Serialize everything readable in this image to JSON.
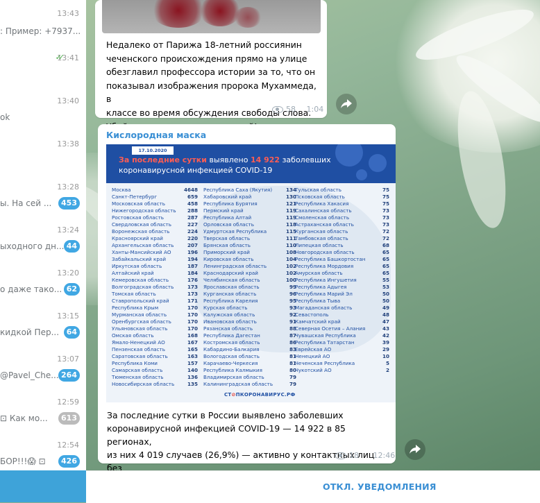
{
  "chat_list": [
    {
      "time": "13:43",
      "preview": "",
      "badge": ""
    },
    {
      "time": "",
      "preview": ": Пример: +7937...",
      "badge": ""
    },
    {
      "time": "13:41",
      "preview": "",
      "badge": "",
      "read": true
    },
    {
      "time": "13:40",
      "preview": "ok",
      "badge": ""
    },
    {
      "time": "13:38",
      "preview": "",
      "badge": ""
    },
    {
      "time": "13:28",
      "preview": "ы.   На сей ...",
      "badge": "453"
    },
    {
      "time": "13:24",
      "preview": "ыходного дн...",
      "badge": "44"
    },
    {
      "time": "13:20",
      "preview": "о даже тако...",
      "badge": "62"
    },
    {
      "time": "13:15",
      "preview": "кидкой  Пер...",
      "badge": "64"
    },
    {
      "time": "13:07",
      "preview": "@Pavel_Che...",
      "badge": "264"
    },
    {
      "time": "12:59",
      "preview": "⊡   Как мо...",
      "badge": "613",
      "muted": true
    },
    {
      "time": "12:54",
      "preview": "БОР!!!😱  ⊡",
      "badge": "426"
    }
  ],
  "messages": [
    {
      "text": "Недалеко от Парижа 18-летний россиянин\nчеченского происхождения прямо на улице\nобезглавил профессора истории за то, что он\nпоказывал изображения пророка Мухаммеда, в\nклассе во время обсуждения свободы слова.\nУбийца ликвидирован полицией!",
      "views": "58",
      "time": "1:04"
    },
    {
      "sender": "Кислородная маска",
      "text": "За последние сутки в России выявлено заболевших\nкоронавирусной инфекцией COVID-19 — 14 922 в 85 регионах,\nиз них 4 019 случаев (26,9%) — активно у контактных лиц без\nклинических проявлений болезни.",
      "views": "18",
      "time": "12:46"
    }
  ],
  "infographic": {
    "date": "17.10.2020 10:40",
    "headline_pre": "За последние сутки",
    "headline_mid": " выявлено ",
    "headline_num": "14 922",
    "headline_post": " заболевших",
    "headline_line2": "коронавирусной инфекцией COVID-19",
    "logo_left": "СТ",
    "logo_mid": "⊘",
    "logo_right": "ПКОРОНАВИРУС.РФ",
    "columns": [
      [
        [
          "Москва",
          "4648"
        ],
        [
          "Санкт-Петербург",
          "659"
        ],
        [
          "Московская область",
          "458"
        ],
        [
          "Нижегородская область",
          "288"
        ],
        [
          "Ростовская область",
          "287"
        ],
        [
          "Свердловская область",
          "227"
        ],
        [
          "Воронежская область",
          "224"
        ],
        [
          "Красноярский край",
          "220"
        ],
        [
          "Архангельская область",
          "207"
        ],
        [
          "Ханты-Мансийский АО",
          "196"
        ],
        [
          "Забайкальский край",
          "194"
        ],
        [
          "Иркутская область",
          "187"
        ],
        [
          "Алтайский край",
          "184"
        ],
        [
          "Кемеровская область",
          "176"
        ],
        [
          "Волгоградская область",
          "173"
        ],
        [
          "Томская область",
          "173"
        ],
        [
          "Ставропольский край",
          "171"
        ],
        [
          "Республика Крым",
          "170"
        ],
        [
          "Мурманская область",
          "170"
        ],
        [
          "Оренбургская область",
          "170"
        ],
        [
          "Ульяновская область",
          "170"
        ],
        [
          "Омская область",
          "168"
        ],
        [
          "Ямало-Ненецкий АО",
          "167"
        ],
        [
          "Пензенская область",
          "165"
        ],
        [
          "Саратовская область",
          "163"
        ],
        [
          "Республика Коми",
          "157"
        ],
        [
          "Самарская область",
          "140"
        ],
        [
          "Тюменская область",
          "136"
        ],
        [
          "Новосибирская область",
          "135"
        ]
      ],
      [
        [
          "Республика Саха (Якутия)",
          "134"
        ],
        [
          "Хабаровский край",
          "130"
        ],
        [
          "Республика Бурятия",
          "121"
        ],
        [
          "Пермский край",
          "119"
        ],
        [
          "Республика Алтай",
          "119"
        ],
        [
          "Орловская область",
          "118"
        ],
        [
          "Удмуртская Республика",
          "115"
        ],
        [
          "Тверская область",
          "111"
        ],
        [
          "Брянская область",
          "110"
        ],
        [
          "Приморский край",
          "108"
        ],
        [
          "Кировская область",
          "104"
        ],
        [
          "Ленинградская область",
          "102"
        ],
        [
          "Краснодарский край",
          "102"
        ],
        [
          "Челябинская область",
          "100"
        ],
        [
          "Ярославская область",
          "99"
        ],
        [
          "Курганская область",
          "96"
        ],
        [
          "Республика Карелия",
          "95"
        ],
        [
          "Курская область",
          "93"
        ],
        [
          "Калужская область",
          "92"
        ],
        [
          "Ивановская область",
          "91"
        ],
        [
          "Рязанская область",
          "88"
        ],
        [
          "Республика Дагестан",
          "87"
        ],
        [
          "Костромская область",
          "86"
        ],
        [
          "Кабардино-Балкария",
          "83"
        ],
        [
          "Вологодская область",
          "81"
        ],
        [
          "Карачаево-Черкесия",
          "81"
        ],
        [
          "Республика Калмыкия",
          "80"
        ],
        [
          "Владимирская область",
          "79"
        ],
        [
          "Калининградская область",
          "79"
        ]
      ],
      [
        [
          "Тульская область",
          "75"
        ],
        [
          "Псковская область",
          "75"
        ],
        [
          "Республика Хакасия",
          "75"
        ],
        [
          "Сахалинская область",
          "73"
        ],
        [
          "Смоленская область",
          "73"
        ],
        [
          "Астраханская область",
          "73"
        ],
        [
          "Курганская область",
          "72"
        ],
        [
          "Тамбовская область",
          "72"
        ],
        [
          "Липецкая область",
          "68"
        ],
        [
          "Новгородская область",
          "65"
        ],
        [
          "Республика Башкортостан",
          "65"
        ],
        [
          "Республика Мордовия",
          "65"
        ],
        [
          "Амурская область",
          "65"
        ],
        [
          "Республика Ингушетия",
          "55"
        ],
        [
          "Республика Адыгея",
          "53"
        ],
        [
          "Республика Марий Эл",
          "50"
        ],
        [
          "Республика Тыва",
          "50"
        ],
        [
          "Магаданская область",
          "49"
        ],
        [
          "Севастополь",
          "48"
        ],
        [
          "Камчатский край",
          "47"
        ],
        [
          "Северная Осетия – Алания",
          "43"
        ],
        [
          "Чувашская Республика",
          "42"
        ],
        [
          "Республика Татарстан",
          "39"
        ],
        [
          "Еврейская АО",
          "29"
        ],
        [
          "Ненецкий АО",
          "10"
        ],
        [
          "Чеченская Республика",
          "5"
        ],
        [
          "Чукотский АО",
          "2"
        ]
      ]
    ]
  },
  "bottom_bar": {
    "button": "ОТКЛ. УВЕДОМЛЕНИЯ"
  },
  "colors": {
    "accent": "#3a8fd4",
    "badge": "#40a7e3",
    "badge_muted": "#bbbbbb",
    "infographic_blue": "#1f4fa3",
    "headline_red": "#ff5d53"
  }
}
